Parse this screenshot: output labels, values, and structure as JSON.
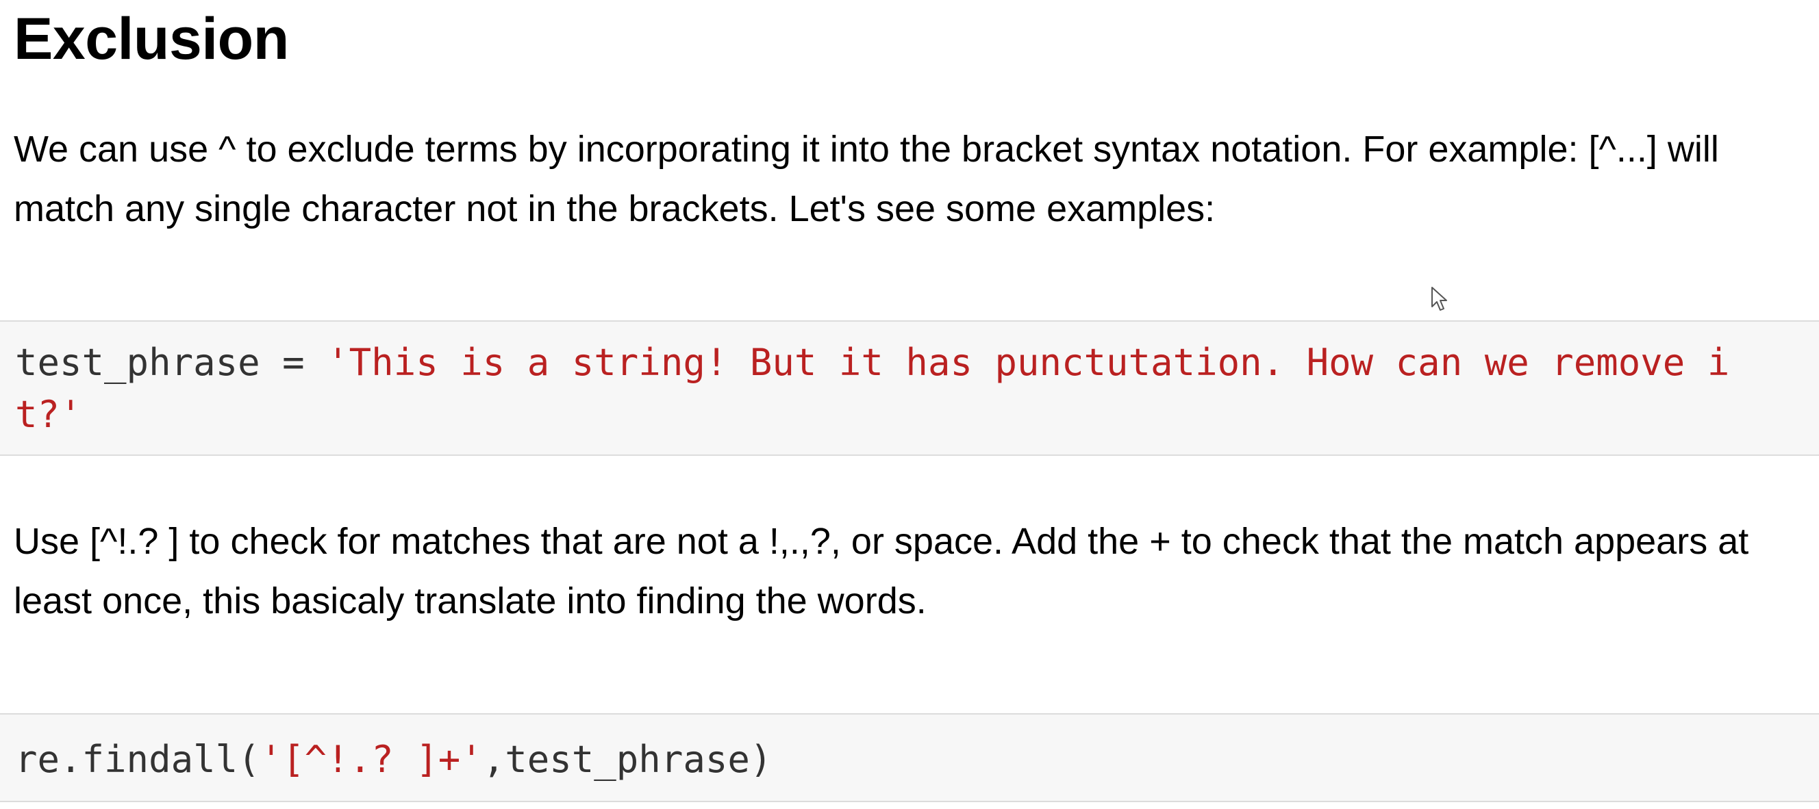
{
  "heading": "Exclusion",
  "paragraph1": "We can use ^ to exclude terms by incorporating it into the bracket syntax notation. For example: [^...] will match any single character not in the brackets. Let's see some examples:",
  "cell1": {
    "code_prefix": "test_phrase = ",
    "code_string": "'This is a string! But it has punctutation. How can we remove it?'"
  },
  "paragraph2": "Use [^!.? ] to check for matches that are not a !,.,?, or space. Add the + to check that the match appears at least once, this basicaly translate into finding the words.",
  "cell2": {
    "code_prefix": "re.findall(",
    "code_string": "'[^!.? ]+'",
    "code_suffix": ",test_phrase)"
  },
  "icons": {
    "cursor": "mouse-pointer-icon"
  }
}
